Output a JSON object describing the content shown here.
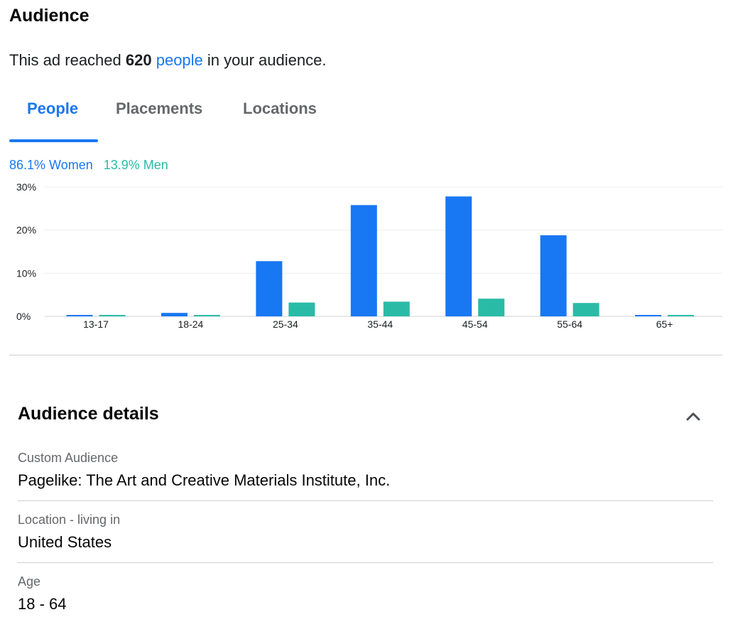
{
  "audience": {
    "title": "Audience",
    "reach_prefix": "This ad reached ",
    "reach_count": "620",
    "reach_link": "people",
    "reach_suffix": " in your audience."
  },
  "tabs": [
    {
      "label": "People",
      "active": true
    },
    {
      "label": "Placements",
      "active": false
    },
    {
      "label": "Locations",
      "active": false
    }
  ],
  "legend": {
    "women": "86.1% Women",
    "men": "13.9% Men"
  },
  "colors": {
    "women": "#1877f2",
    "men": "#2abba7",
    "accent": "#1877f2"
  },
  "chart_data": {
    "type": "bar",
    "categories": [
      "13-17",
      "18-24",
      "25-34",
      "35-44",
      "45-54",
      "55-64",
      "65+"
    ],
    "series": [
      {
        "name": "Women",
        "values": [
          0.3,
          0.8,
          12.8,
          25.8,
          27.8,
          18.8,
          0.3
        ]
      },
      {
        "name": "Men",
        "values": [
          0.3,
          0.3,
          3.2,
          3.4,
          4.1,
          3.1,
          0.3
        ]
      }
    ],
    "yticks": [
      "0%",
      "10%",
      "20%",
      "30%"
    ],
    "ylim": [
      0,
      30
    ],
    "grid": true,
    "xlabel": "",
    "ylabel": ""
  },
  "details": {
    "title": "Audience details",
    "items": [
      {
        "label": "Custom Audience",
        "value": "Pagelike: The Art and Creative Materials Institute, Inc."
      },
      {
        "label": "Location - living in",
        "value": "United States"
      },
      {
        "label": "Age",
        "value": "18 - 64"
      }
    ]
  }
}
